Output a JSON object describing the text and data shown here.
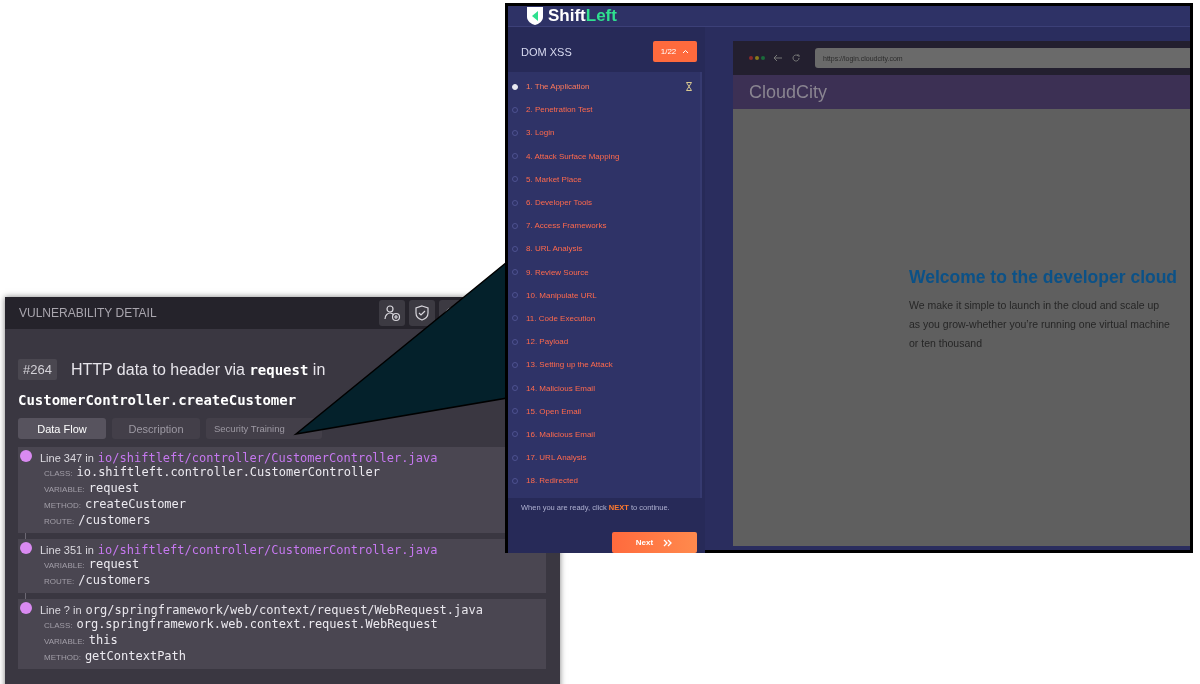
{
  "vulnerability_detail": {
    "title": "VULNERABILITY DETAIL",
    "id_badge": "#264",
    "heading": "HTTP data to header via **request** in",
    "method": "CustomerController.createCustomer",
    "tabs": [
      {
        "label": "Data Flow",
        "selected": true
      },
      {
        "label": "Description",
        "selected": false
      },
      {
        "label": "Security Training",
        "selected": false
      }
    ],
    "flow": [
      {
        "line": "Line 347 in",
        "path": "io/shiftleft/controller/CustomerController.java",
        "linked": true,
        "fields": [
          {
            "label": "CLASS:",
            "value": "io.shiftleft.controller.CustomerController"
          },
          {
            "label": "VARIABLE:",
            "value": "request"
          },
          {
            "label": "METHOD:",
            "value": "createCustomer"
          },
          {
            "label": "ROUTE:",
            "value": "/customers"
          }
        ]
      },
      {
        "line": "Line 351 in",
        "path": "io/shiftleft/controller/CustomerController.java",
        "linked": true,
        "fields": [
          {
            "label": "VARIABLE:",
            "value": "request"
          },
          {
            "label": "ROUTE:",
            "value": "/customers"
          }
        ]
      },
      {
        "line": "Line ? in",
        "path": "org/springframework/web/context/request/WebRequest.java",
        "linked": false,
        "fields": [
          {
            "label": "CLASS:",
            "value": "org.springframework.web.context.request.WebRequest"
          },
          {
            "label": "VARIABLE:",
            "value": "this"
          },
          {
            "label": "METHOD:",
            "value": "getContextPath"
          }
        ]
      }
    ]
  },
  "training": {
    "brand": {
      "text_1": "Shift",
      "text_2": "Left"
    },
    "lesson": "DOM XSS",
    "progress": "1/22",
    "steps": [
      {
        "label": "1. The Application",
        "selected": true
      },
      {
        "label": "2. Penetration Test",
        "selected": false
      },
      {
        "label": "3. Login",
        "selected": false
      },
      {
        "label": "4. Attack Surface Mapping",
        "selected": false
      },
      {
        "label": "5. Market Place",
        "selected": false
      },
      {
        "label": "6. Developer Tools",
        "selected": false
      },
      {
        "label": "7. Access Frameworks",
        "selected": false
      },
      {
        "label": "8. URL Analysis",
        "selected": false
      },
      {
        "label": "9. Review Source",
        "selected": false
      },
      {
        "label": "10. Manipulate URL",
        "selected": false
      },
      {
        "label": "11. Code Execution",
        "selected": false
      },
      {
        "label": "12. Payload",
        "selected": false
      },
      {
        "label": "13. Setting up the Attack",
        "selected": false
      },
      {
        "label": "14. Malicious Email",
        "selected": false
      },
      {
        "label": "15. Open Email",
        "selected": false
      },
      {
        "label": "16. Malicious Email",
        "selected": false
      },
      {
        "label": "17. URL Analysis",
        "selected": false
      },
      {
        "label": "18. Redirected",
        "selected": false
      }
    ],
    "hint": "When you are ready, click **NEXT** to continue.",
    "next_button": "Next",
    "browser": {
      "url": "https://login.cloudcity.com",
      "site_name": "CloudCity",
      "heading": "Welcome to the developer cloud",
      "body": "We make it simple to launch in the cloud and scale up as you grow-whether you’re running one virtual machine or ten thousand"
    }
  }
}
